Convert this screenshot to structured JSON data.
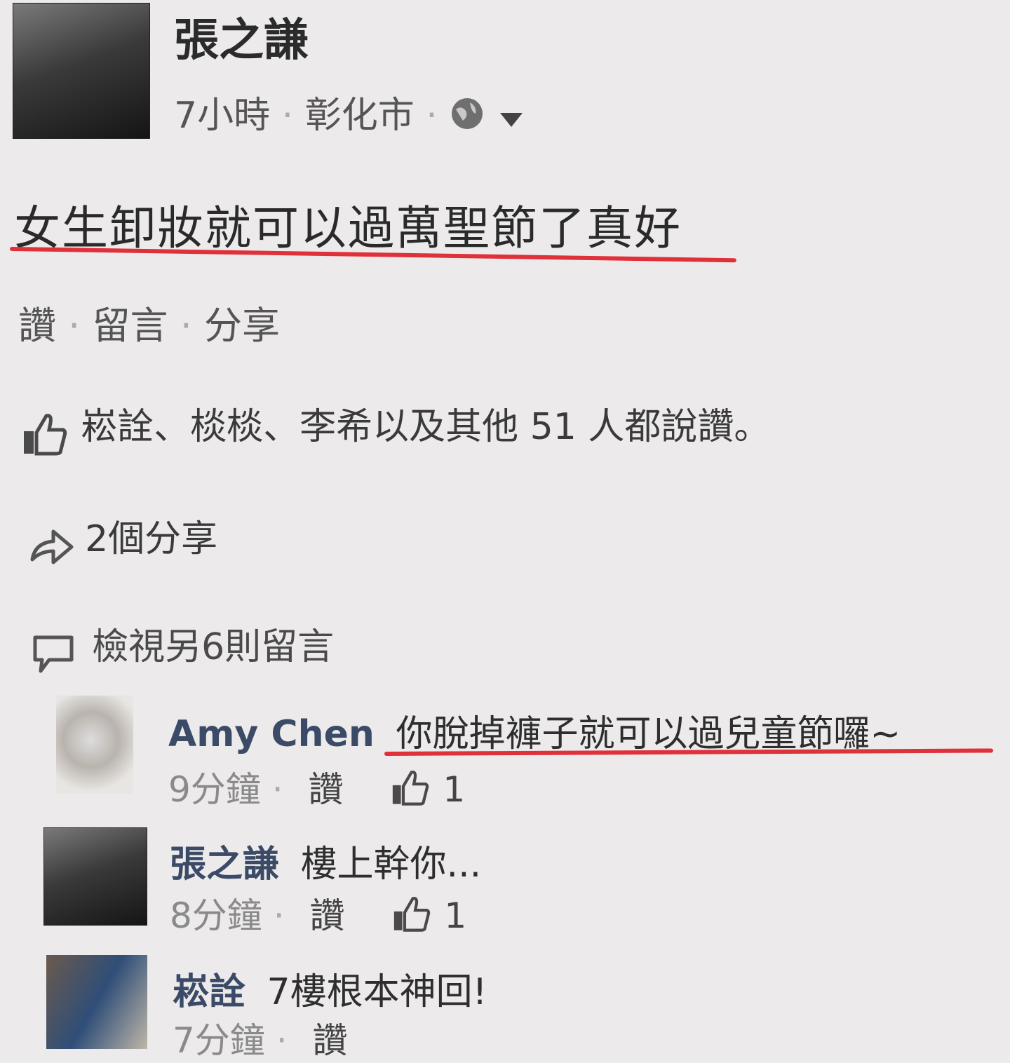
{
  "post": {
    "author": "張之謙",
    "time": "7小時",
    "location": "彰化市",
    "separator": "·",
    "privacy_icon": "globe-icon",
    "dropdown_icon": "caret-down-icon",
    "text": "女生卸妝就可以過萬聖節了真好"
  },
  "actions": {
    "like": "讚",
    "comment": "留言",
    "share": "分享"
  },
  "summary": {
    "likes_text": "崧詮、棪棪、李希以及其他 51 人都說讚。",
    "shares_text": "2個分享",
    "view_more_comments": "檢視另6則留言"
  },
  "comments": [
    {
      "author": "Amy Chen",
      "text": "你脫掉褲子就可以過兒童節囉~",
      "time": "9分鐘",
      "like_label": "讚",
      "like_count": "1"
    },
    {
      "author": "張之謙",
      "text": "樓上幹你...",
      "time": "8分鐘",
      "like_label": "讚",
      "like_count": "1"
    },
    {
      "author": "崧詮",
      "text": "7樓根本神回!",
      "time": "7分鐘",
      "like_label": "讚"
    }
  ],
  "colors": {
    "underline": "#e0303a",
    "background": "#eceaea",
    "comment_name": "#3b4a66"
  }
}
